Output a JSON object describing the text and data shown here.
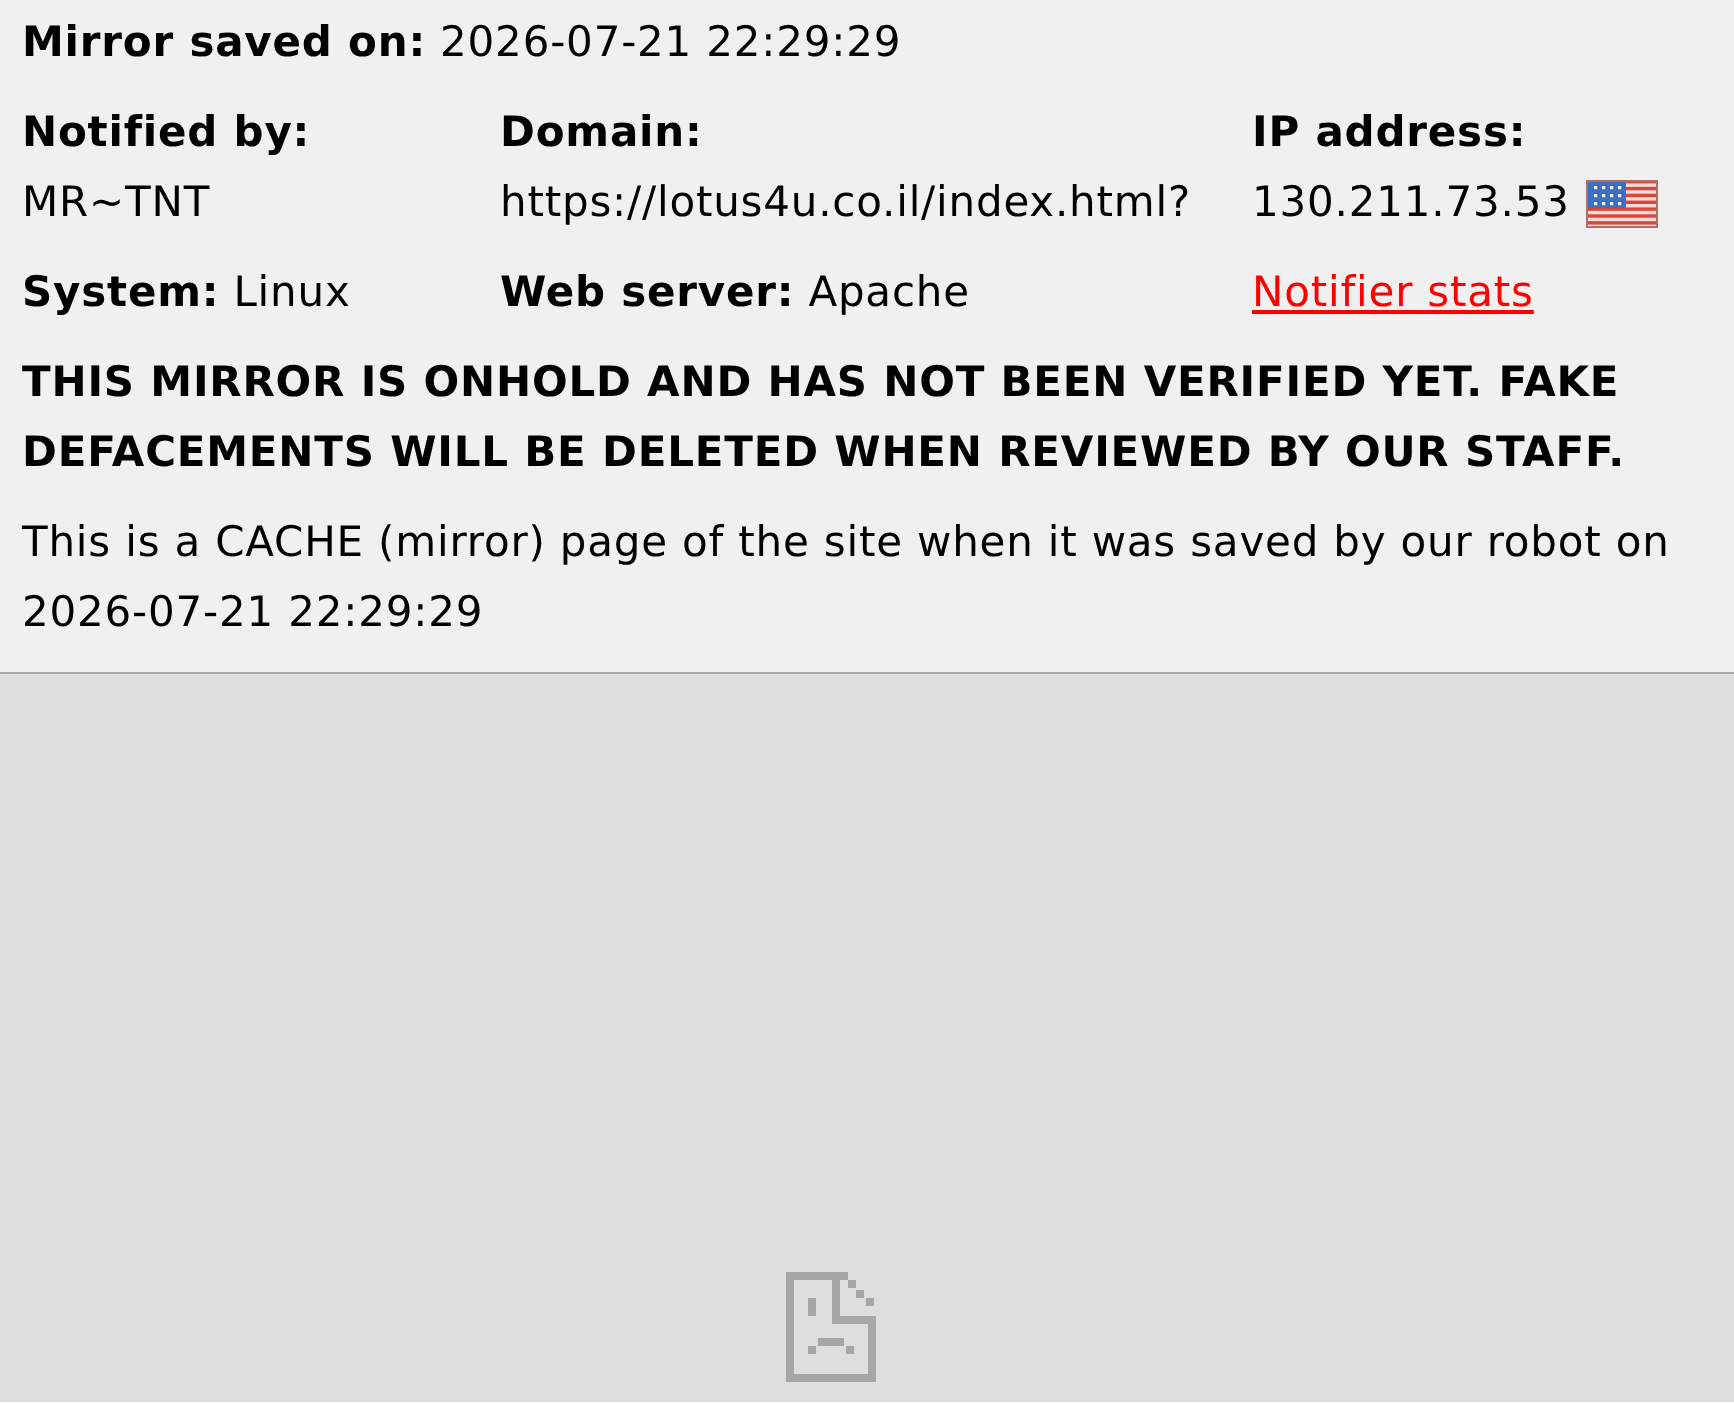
{
  "saved_line": {
    "label": "Mirror saved on:",
    "value": "2026-07-21 22:29:29"
  },
  "stacked_fields": [
    {
      "label": "Notified by:",
      "value": "MR~TNT",
      "kind": "text"
    },
    {
      "label": "Domain:",
      "value": "https://lotus4u.co.il/index.html?",
      "kind": "text"
    },
    {
      "label": "IP address:",
      "value": "130.211.73.53",
      "kind": "ip_with_flag"
    }
  ],
  "inline_fields": [
    {
      "label": "System:",
      "value": "Linux"
    },
    {
      "label": "Web server:",
      "value": "Apache"
    }
  ],
  "stats_link": "Notifier stats",
  "warning": "THIS MIRROR IS ONHOLD AND HAS NOT BEEN VERIFIED YET. FAKE DEFACEMENTS WILL BE DELETED WHEN REVIEWED BY OUR STAFF.",
  "notice": "This is a CACHE (mirror) page of the site when it was saved by our robot on 2026-07-21 22:29:29"
}
